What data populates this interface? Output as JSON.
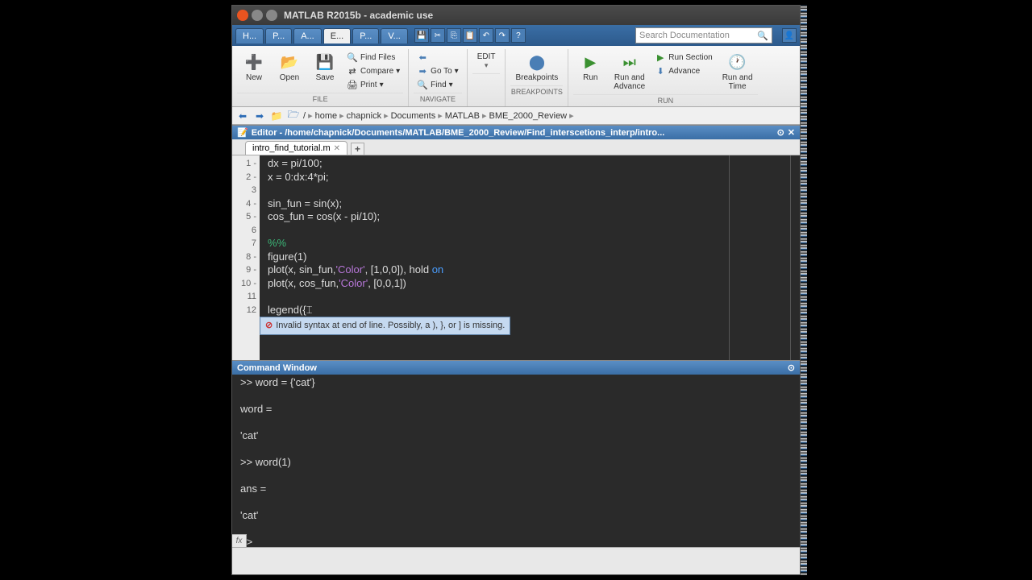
{
  "titlebar": {
    "title": "MATLAB R2015b - academic use"
  },
  "tabs": {
    "items": [
      "H...",
      "P...",
      "A...",
      "E...",
      "P...",
      "V..."
    ],
    "active_index": 3,
    "search_placeholder": "Search Documentation"
  },
  "ribbon": {
    "file": {
      "label": "FILE",
      "new": "New",
      "open": "Open",
      "save": "Save",
      "find_files": "Find Files",
      "compare": "Compare",
      "print": "Print"
    },
    "navigate": {
      "label": "NAVIGATE",
      "goto": "Go To",
      "find": "Find"
    },
    "edit": {
      "label": "EDIT"
    },
    "breakpoints": {
      "label": "BREAKPOINTS",
      "btn": "Breakpoints"
    },
    "run": {
      "label": "RUN",
      "run_btn": "Run",
      "run_advance": "Run and\nAdvance",
      "run_section": "Run Section",
      "advance": "Advance",
      "run_time": "Run and\nTime"
    }
  },
  "address": {
    "segs": [
      "/",
      "home",
      "chapnick",
      "Documents",
      "MATLAB",
      "BME_2000_Review"
    ]
  },
  "editor": {
    "header": "Editor - /home/chapnick/Documents/MATLAB/BME_2000_Review/Find_interscetions_interp/intro...",
    "file_tab": "intro_find_tutorial.m",
    "lines": {
      "l1": "dx = pi/100;",
      "l2": "x = 0:dx:4*pi;",
      "l4": "sin_fun = sin(x);",
      "l5": "cos_fun = cos(x - pi/10);",
      "l7": "%%",
      "l8": "figure(1)",
      "l9a": "plot(x, sin_fun,",
      "l9b": "'Color'",
      "l9c": ", [1,0,0]), hold ",
      "l9d": "on",
      "l10a": "plot(x, cos_fun,",
      "l10b": "'Color'",
      "l10c": ", [0,0,1])",
      "l12": "legend({"
    },
    "error_msg": "Invalid syntax at end of line. Possibly, a ), }, or ] is missing."
  },
  "command_window": {
    "header": "Command Window",
    "lines": {
      "l1": ">> word = {'cat'}",
      "l2": "word =",
      "l3": "    'cat'",
      "l4": ">> word(1)",
      "l5": "ans =",
      "l6": "    'cat'",
      "l7": ">>"
    }
  }
}
